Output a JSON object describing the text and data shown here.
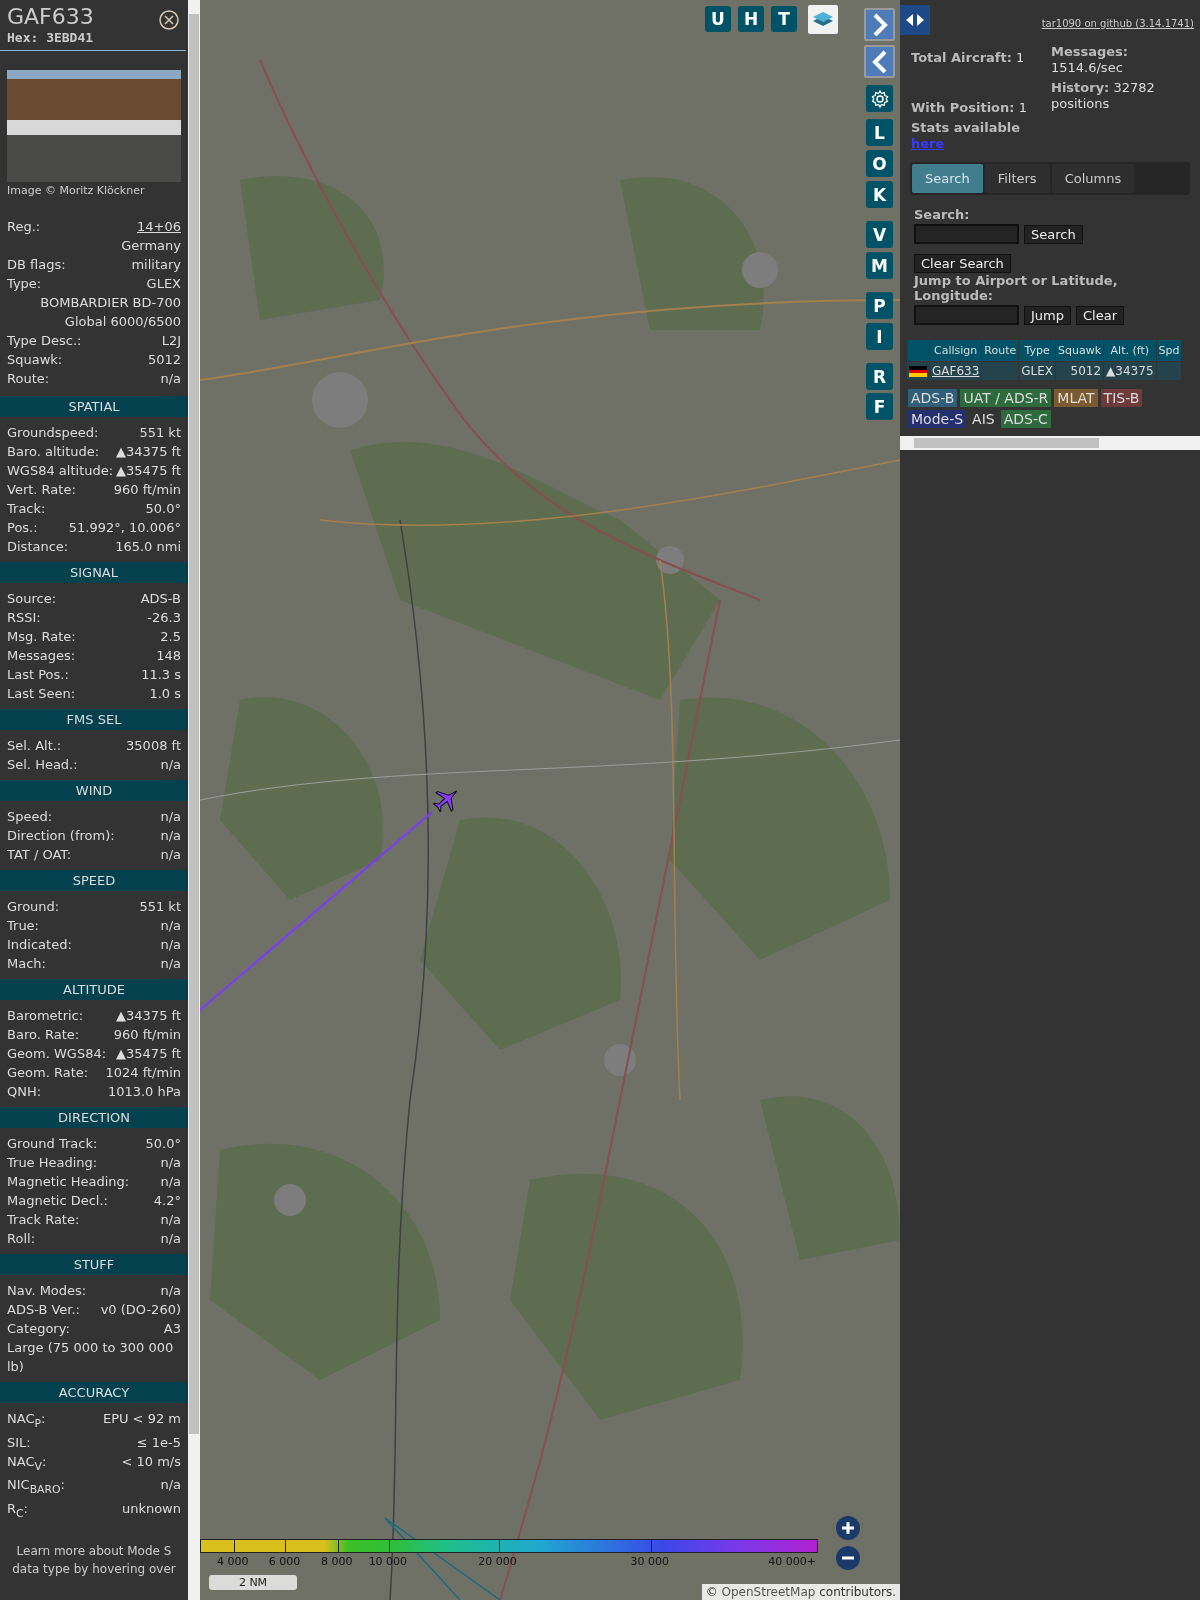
{
  "aircraft": {
    "callsign": "GAF633",
    "hex": "Hex: 3EBD41",
    "photo_credit": "Image © Moritz Klöckner",
    "rows": [
      {
        "kind": "link",
        "label": "Reg.:",
        "value": "14+06"
      },
      {
        "kind": "value",
        "value": "Germany"
      },
      {
        "kind": "pair",
        "label": "DB flags:",
        "value": "military"
      },
      {
        "kind": "pair",
        "label": "Type:",
        "value": "GLEX"
      },
      {
        "kind": "value",
        "value": "BOMBARDIER BD-700 Global 6000/6500"
      },
      {
        "kind": "pair",
        "label": "Type Desc.:",
        "value": "L2J"
      },
      {
        "kind": "pair",
        "label": "Squawk:",
        "value": "5012"
      },
      {
        "kind": "pair",
        "label": "Route:",
        "value": "n/a"
      }
    ]
  },
  "sections": [
    {
      "title": "SPATIAL",
      "rows": [
        {
          "kind": "pair",
          "label": "Groundspeed:",
          "value": "551 kt"
        },
        {
          "kind": "pair",
          "label": "Baro. altitude:",
          "value": "▲34375 ft"
        },
        {
          "kind": "pair",
          "label": "WGS84 altitude:",
          "value": "▲35475 ft"
        },
        {
          "kind": "pair",
          "label": "Vert. Rate:",
          "value": "960 ft/min"
        },
        {
          "kind": "pair",
          "label": "Track:",
          "value": "50.0°"
        },
        {
          "kind": "pair",
          "label": "Pos.:",
          "value": "51.992°, 10.006°"
        },
        {
          "kind": "pair",
          "label": "Distance:",
          "value": "165.0 nmi"
        }
      ]
    },
    {
      "title": "SIGNAL",
      "rows": [
        {
          "kind": "pair",
          "label": "Source:",
          "value": "ADS-B"
        },
        {
          "kind": "pair",
          "label": "RSSI:",
          "value": "-26.3"
        },
        {
          "kind": "pair",
          "label": "Msg. Rate:",
          "value": "2.5"
        },
        {
          "kind": "pair",
          "label": "Messages:",
          "value": "148"
        },
        {
          "kind": "pair",
          "label": "Last Pos.:",
          "value": "11.3 s"
        },
        {
          "kind": "pair",
          "label": "Last Seen:",
          "value": "1.0 s"
        }
      ]
    },
    {
      "title": "FMS SEL",
      "rows": [
        {
          "kind": "pair",
          "label": "Sel. Alt.:",
          "value": "35008 ft"
        },
        {
          "kind": "pair",
          "label": "Sel. Head.:",
          "value": "n/a"
        }
      ]
    },
    {
      "title": "WIND",
      "rows": [
        {
          "kind": "pair",
          "label": "Speed:",
          "value": "n/a"
        },
        {
          "kind": "pair",
          "label": "Direction (from):",
          "value": "n/a"
        },
        {
          "kind": "pair",
          "label": "TAT / OAT:",
          "value": "n/a"
        }
      ]
    },
    {
      "title": "SPEED",
      "rows": [
        {
          "kind": "pair",
          "label": "Ground:",
          "value": "551 kt"
        },
        {
          "kind": "pair",
          "label": "True:",
          "value": "n/a"
        },
        {
          "kind": "pair",
          "label": "Indicated:",
          "value": "n/a"
        },
        {
          "kind": "pair",
          "label": "Mach:",
          "value": "n/a"
        }
      ]
    },
    {
      "title": "ALTITUDE",
      "rows": [
        {
          "kind": "pair",
          "label": "Barometric:",
          "value": "▲34375 ft"
        },
        {
          "kind": "pair",
          "label": "Baro. Rate:",
          "value": "960 ft/min"
        },
        {
          "kind": "pair",
          "label": "Geom. WGS84:",
          "value": "▲35475 ft"
        },
        {
          "kind": "pair",
          "label": "Geom. Rate:",
          "value": "1024 ft/min"
        },
        {
          "kind": "pair",
          "label": "QNH:",
          "value": "1013.0 hPa"
        }
      ]
    },
    {
      "title": "DIRECTION",
      "rows": [
        {
          "kind": "pair",
          "label": "Ground Track:",
          "value": "50.0°"
        },
        {
          "kind": "pair",
          "label": "True Heading:",
          "value": "n/a"
        },
        {
          "kind": "pair",
          "label": "Magnetic Heading:",
          "value": "n/a"
        },
        {
          "kind": "pair",
          "label": "Magnetic Decl.:",
          "value": "4.2°"
        },
        {
          "kind": "pair",
          "label": "Track Rate:",
          "value": "n/a"
        },
        {
          "kind": "pair",
          "label": "Roll:",
          "value": "n/a"
        }
      ]
    },
    {
      "title": "STUFF",
      "rows": [
        {
          "kind": "pair",
          "label": "Nav. Modes:",
          "value": "n/a"
        },
        {
          "kind": "pair",
          "label": "ADS-B Ver.:",
          "value": "v0 (DO-260)"
        },
        {
          "kind": "pair",
          "label": "Category:",
          "value": "A3"
        },
        {
          "kind": "note",
          "value": "Large (75 000 to 300 000 lb)"
        }
      ]
    },
    {
      "title": "ACCURACY",
      "rows": [
        {
          "kind": "pair",
          "label": "NAC$_{P}$:",
          "value": "EPU < 92 m"
        },
        {
          "kind": "pair",
          "label": "SIL:",
          "value": "≤ 1e-5"
        },
        {
          "kind": "pair",
          "label": "NAC$_{V}$:",
          "value": "< 10 m/s"
        },
        {
          "kind": "pair",
          "label": "NIC$_{BARO}$:",
          "value": "n/a"
        },
        {
          "kind": "pair",
          "label": "R$_{C}$:",
          "value": "unknown"
        }
      ]
    }
  ],
  "footer_note": "Learn more about Mode S data type by hovering over",
  "map": {
    "top_buttons": [
      "U",
      "H",
      "T"
    ],
    "side_buttons": [
      {
        "kind": "next"
      },
      {
        "kind": "prev"
      },
      {
        "kind": "settings"
      },
      {
        "kind": "letter",
        "label": "L"
      },
      {
        "kind": "letter",
        "label": "O"
      },
      {
        "kind": "letter",
        "label": "K"
      },
      {
        "kind": "letter",
        "label": "V"
      },
      {
        "kind": "letter",
        "label": "M"
      },
      {
        "kind": "letter",
        "label": "P"
      },
      {
        "kind": "letter",
        "label": "I"
      },
      {
        "kind": "letter",
        "label": "R"
      },
      {
        "kind": "letter",
        "label": "F"
      }
    ],
    "altitude_legend": [
      "4 000",
      "6 000",
      "8 000",
      "10 000",
      "20 000",
      "30 000",
      "40 000+"
    ],
    "scale": "2 NM",
    "attribution": {
      "prefix": "©",
      "link": "OpenStreetMap",
      "suffix": "contributors."
    }
  },
  "right_panel": {
    "version_link": "tar1090 on github (3.14.1741)",
    "stats": {
      "total_aircraft": "**Total Aircraft:** 1",
      "with_position": "**With Position:** 1",
      "stats_label": "Stats available",
      "stats_link": "here",
      "messages": "**Messages:** 1514.6/sec",
      "history": "**History:** 32782 positions"
    },
    "tabs": [
      {
        "label": "Search",
        "selected": true
      },
      {
        "label": "Filters",
        "selected": false
      },
      {
        "label": "Columns",
        "selected": false
      }
    ],
    "search": {
      "label": "Search:",
      "button": "Search",
      "clear_button": "Clear Search",
      "jump_label": "Jump to Airport or Latitude, Longitude:",
      "jump_button": "Jump",
      "jump_clear": "Clear"
    },
    "table": {
      "columns": [
        "Callsign",
        "Route",
        "Type",
        "Squawk",
        "Alt. (ft)",
        "Spd"
      ],
      "rows": [
        {
          "callsign": "GAF633",
          "type": "GLEX",
          "squawk": "5012",
          "altitude": "▲34375"
        }
      ]
    },
    "source_legend": [
      {
        "label": "ADS-B",
        "color": "#2f5f78"
      },
      {
        "label": "UAT / ADS-R",
        "color": "#2d6a3c"
      },
      {
        "label": "MLAT",
        "color": "#7a5a30"
      },
      {
        "label": "TIS-B",
        "color": "#6e3a3a"
      },
      {
        "label": "Mode-S",
        "color": "#24306e"
      },
      {
        "label": "AIS"
      },
      {
        "label": "ADS-C",
        "color": "#2d6a3c"
      }
    ]
  }
}
